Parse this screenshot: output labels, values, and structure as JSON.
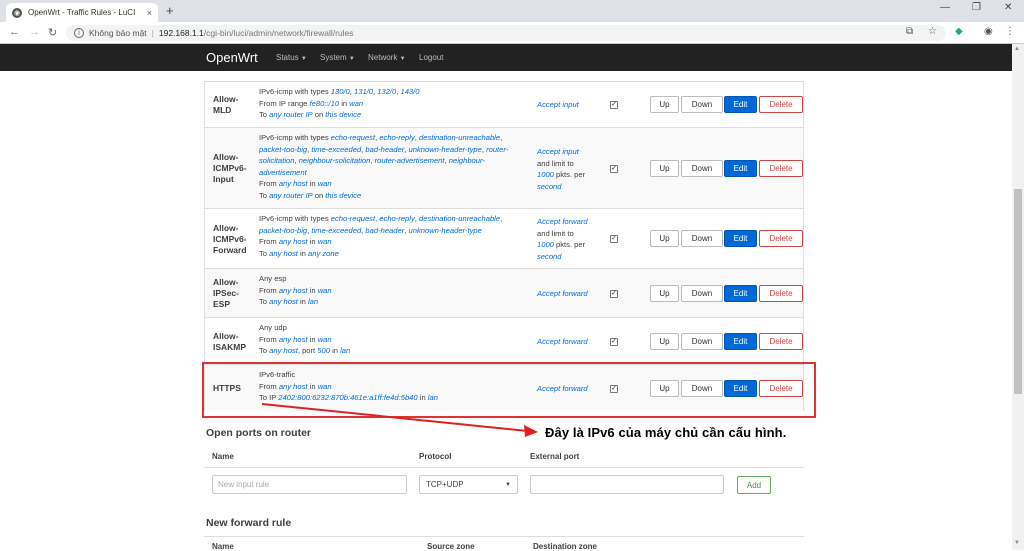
{
  "browser": {
    "tab_title": "OpenWrt - Traffic Rules - LuCI",
    "tab_close": "×",
    "new_tab": "+",
    "favicon": "openwrt-icon",
    "insecure_label": "Không bảo mật",
    "url_host": "192.168.1.1",
    "url_path": "/cgi-bin/luci/admin/network/firewall/rules"
  },
  "header": {
    "brand": "OpenWrt",
    "menu": [
      "Status",
      "System",
      "Network",
      "Logout"
    ]
  },
  "buttons": {
    "up": "Up",
    "down": "Down",
    "edit": "Edit",
    "delete": "Delete"
  },
  "rules": [
    {
      "name": "Allow-\nMLD",
      "match_lines": [
        [
          {
            "t": "IPv6-icmp with types "
          },
          {
            "i": "130/0"
          },
          {
            "t": ", "
          },
          {
            "i": "131/0"
          },
          {
            "t": ", "
          },
          {
            "i": "132/0"
          },
          {
            "t": ", "
          },
          {
            "i": "143/0"
          }
        ],
        [
          {
            "t": "From IP range "
          },
          {
            "i": "fe80::/10"
          },
          {
            "t": " in "
          },
          {
            "i": "wan"
          }
        ],
        [
          {
            "t": "To "
          },
          {
            "i": "any router IP"
          },
          {
            "t": " on "
          },
          {
            "i": "this device"
          }
        ]
      ],
      "target_lines": [
        [
          {
            "i": "Accept input"
          }
        ]
      ],
      "checked": true
    },
    {
      "name": "Allow-\nICMPv6-\nInput",
      "match_lines": [
        [
          {
            "t": "IPv6-icmp with types "
          },
          {
            "i": "echo-request"
          },
          {
            "t": ", "
          },
          {
            "i": "echo-reply"
          },
          {
            "t": ", "
          },
          {
            "i": "destination-unreachable"
          },
          {
            "t": ","
          }
        ],
        [
          {
            "i": "packet-too-big"
          },
          {
            "t": ", "
          },
          {
            "i": "time-exceeded"
          },
          {
            "t": ", "
          },
          {
            "i": "bad-header"
          },
          {
            "t": ", "
          },
          {
            "i": "unknown-header-type"
          },
          {
            "t": ", "
          },
          {
            "i": "router-"
          }
        ],
        [
          {
            "i": "solicitation"
          },
          {
            "t": ", "
          },
          {
            "i": "neighbour-solicitation"
          },
          {
            "t": ", "
          },
          {
            "i": "router-advertisement"
          },
          {
            "t": ", "
          },
          {
            "i": "neighbour-"
          }
        ],
        [
          {
            "i": "advertisement"
          }
        ],
        [
          {
            "t": "From "
          },
          {
            "i": "any host"
          },
          {
            "t": " in "
          },
          {
            "i": "wan"
          }
        ],
        [
          {
            "t": "To "
          },
          {
            "i": "any router IP"
          },
          {
            "t": " on "
          },
          {
            "i": "this device"
          }
        ]
      ],
      "target_lines": [
        [
          {
            "i": "Accept input"
          }
        ],
        [
          {
            "t": "and limit to"
          }
        ],
        [
          {
            "i": "1000"
          },
          {
            "t": " pkts. per"
          }
        ],
        [
          {
            "i": "second"
          }
        ]
      ],
      "checked": true
    },
    {
      "name": "Allow-\nICMPv6-\nForward",
      "match_lines": [
        [
          {
            "t": "IPv6-icmp with types "
          },
          {
            "i": "echo-request"
          },
          {
            "t": ", "
          },
          {
            "i": "echo-reply"
          },
          {
            "t": ", "
          },
          {
            "i": "destination-unreachable"
          },
          {
            "t": ","
          }
        ],
        [
          {
            "i": "packet-too-big"
          },
          {
            "t": ", "
          },
          {
            "i": "time-exceeded"
          },
          {
            "t": ", "
          },
          {
            "i": "bad-header"
          },
          {
            "t": ", "
          },
          {
            "i": "unknown-header-type"
          }
        ],
        [
          {
            "t": "From "
          },
          {
            "i": "any host"
          },
          {
            "t": " in "
          },
          {
            "i": "wan"
          }
        ],
        [
          {
            "t": "To "
          },
          {
            "i": "any host"
          },
          {
            "t": " in "
          },
          {
            "i": "any zone"
          }
        ]
      ],
      "target_lines": [
        [
          {
            "i": "Accept forward"
          }
        ],
        [
          {
            "t": "and limit to"
          }
        ],
        [
          {
            "i": "1000"
          },
          {
            "t": " pkts. per"
          }
        ],
        [
          {
            "i": "second"
          }
        ]
      ],
      "checked": true
    },
    {
      "name": "Allow-\nIPSec-\nESP",
      "match_lines": [
        [
          {
            "t": "Any esp"
          }
        ],
        [
          {
            "t": "From "
          },
          {
            "i": "any host"
          },
          {
            "t": " in "
          },
          {
            "i": "wan"
          }
        ],
        [
          {
            "t": "To "
          },
          {
            "i": "any host"
          },
          {
            "t": " in "
          },
          {
            "i": "lan"
          }
        ]
      ],
      "target_lines": [
        [
          {
            "i": "Accept forward"
          }
        ]
      ],
      "checked": true
    },
    {
      "name": "Allow-\nISAKMP",
      "match_lines": [
        [
          {
            "t": "Any udp"
          }
        ],
        [
          {
            "t": "From "
          },
          {
            "i": "any host"
          },
          {
            "t": " in "
          },
          {
            "i": "wan"
          }
        ],
        [
          {
            "t": "To "
          },
          {
            "i": "any host"
          },
          {
            "t": ", port "
          },
          {
            "i": "500"
          },
          {
            "t": " in "
          },
          {
            "i": "lan"
          }
        ]
      ],
      "target_lines": [
        [
          {
            "i": "Accept forward"
          }
        ]
      ],
      "checked": true
    },
    {
      "name": "HTTPS",
      "match_lines": [
        [
          {
            "t": "IPv6-traffic"
          }
        ],
        [
          {
            "t": "From "
          },
          {
            "i": "any host"
          },
          {
            "t": " in "
          },
          {
            "i": "wan"
          }
        ],
        [
          {
            "t": "To IP "
          },
          {
            "i": "2402:800:6232:870b:461e:a1ff:fe4d:5b40"
          },
          {
            "t": " in "
          },
          {
            "i": "lan"
          }
        ]
      ],
      "target_lines": [
        [
          {
            "i": "Accept forward"
          }
        ]
      ],
      "checked": true
    }
  ],
  "annotation": "Đây là IPv6 của máy chủ cần cấu hình.",
  "open_ports": {
    "title": "Open ports on router",
    "col_name": "Name",
    "col_protocol": "Protocol",
    "col_external_port": "External port",
    "name_placeholder": "New input rule",
    "protocol_value": "TCP+UDP",
    "add_label": "Add"
  },
  "new_forward": {
    "title": "New forward rule",
    "col_name": "Name",
    "col_source_zone": "Source zone",
    "col_destination_zone": "Destination zone"
  }
}
